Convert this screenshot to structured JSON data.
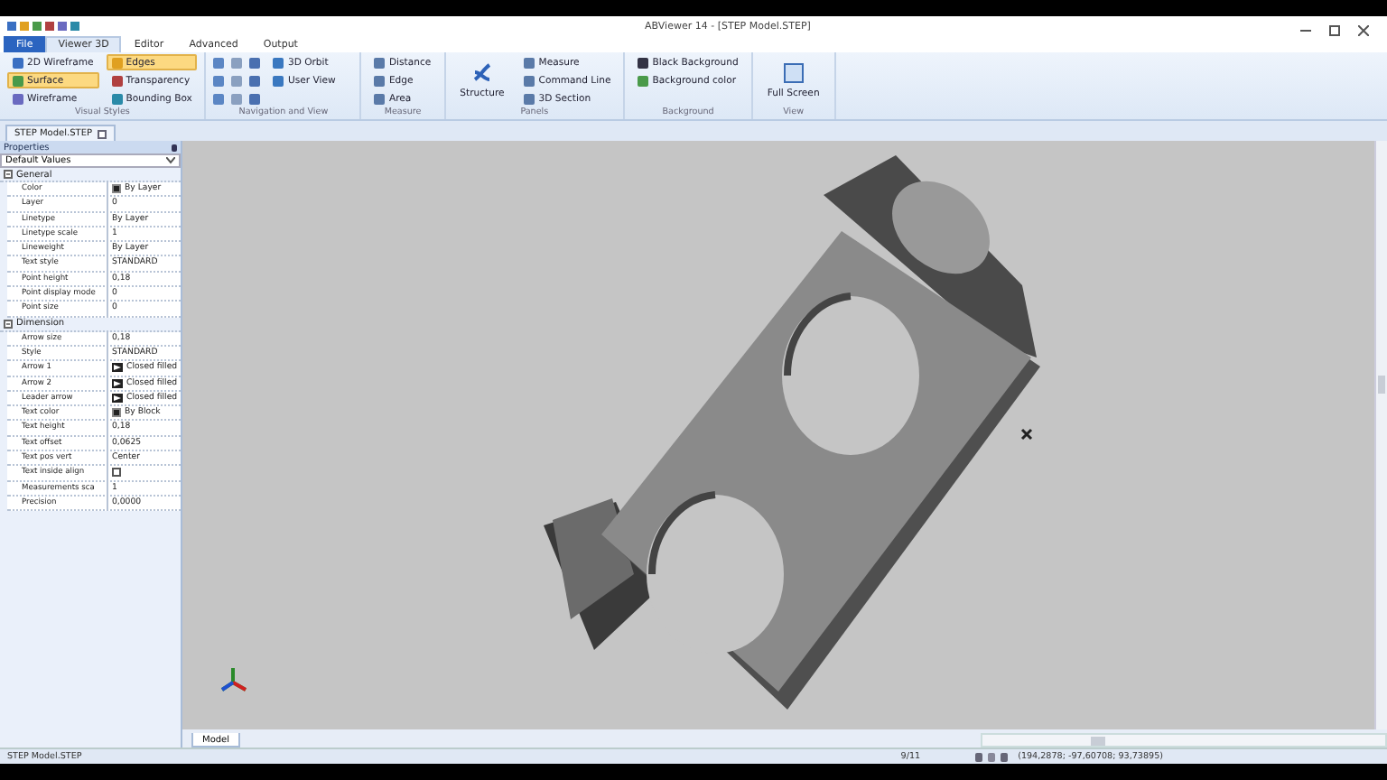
{
  "window": {
    "title": "ABViewer 14 - [STEP Model.STEP]"
  },
  "menu_tabs": [
    {
      "label": "File",
      "kind": "file",
      "selected": false
    },
    {
      "label": "Viewer 3D",
      "kind": "tab",
      "selected": true
    },
    {
      "label": "Editor",
      "kind": "tab",
      "selected": false
    },
    {
      "label": "Advanced",
      "kind": "tab",
      "selected": false
    },
    {
      "label": "Output",
      "kind": "tab",
      "selected": false
    }
  ],
  "ribbon": {
    "visual_styles": {
      "name": "Visual Styles",
      "items": [
        {
          "label": "2D Wireframe",
          "selected": false
        },
        {
          "label": "Edges",
          "selected": true
        },
        {
          "label": "Surface",
          "selected": true
        },
        {
          "label": "Transparency",
          "selected": false
        },
        {
          "label": "Wireframe",
          "selected": false
        },
        {
          "label": "Bounding Box",
          "selected": false
        }
      ]
    },
    "navigation": {
      "name": "Navigation and View",
      "items": [
        "3D Orbit",
        "User View"
      ]
    },
    "measure": {
      "name": "Measure",
      "items": [
        "Distance",
        "Edge",
        "Area"
      ]
    },
    "panels": {
      "name": "Panels",
      "large": "Structure",
      "items": [
        "Measure",
        "Command Line",
        "3D Section"
      ]
    },
    "background": {
      "name": "Background",
      "items": [
        "Black Background",
        "Background color"
      ]
    },
    "view": {
      "name": "View",
      "large": "Full Screen"
    }
  },
  "document_tab": "STEP Model.STEP",
  "properties": {
    "title": "Properties",
    "preset": "Default Values",
    "sections": [
      {
        "name": "General",
        "expanded": true,
        "rows": [
          {
            "name": "Color",
            "value": "By Layer",
            "kind": "swatch"
          },
          {
            "name": "Layer",
            "value": "0",
            "kind": "text"
          },
          {
            "name": "Linetype",
            "value": "By Layer",
            "kind": "text"
          },
          {
            "name": "Linetype scale",
            "value": "1",
            "kind": "text"
          },
          {
            "name": "Lineweight",
            "value": "By Layer",
            "kind": "text"
          },
          {
            "name": "Text style",
            "value": "STANDARD",
            "kind": "text"
          },
          {
            "name": "Point height",
            "value": "0,18",
            "kind": "text"
          },
          {
            "name": "Point display mode",
            "value": "0",
            "kind": "text"
          },
          {
            "name": "Point size",
            "value": "0",
            "kind": "text"
          }
        ]
      },
      {
        "name": "Dimension",
        "expanded": true,
        "rows": [
          {
            "name": "Arrow size",
            "value": "0,18",
            "kind": "text"
          },
          {
            "name": "Style",
            "value": "STANDARD",
            "kind": "text"
          },
          {
            "name": "Arrow 1",
            "value": "Closed filled",
            "kind": "arrow"
          },
          {
            "name": "Arrow 2",
            "value": "Closed filled",
            "kind": "arrow"
          },
          {
            "name": "Leader arrow",
            "value": "Closed filled",
            "kind": "arrow"
          },
          {
            "name": "Text color",
            "value": "By Block",
            "kind": "swatch"
          },
          {
            "name": "Text height",
            "value": "0,18",
            "kind": "text"
          },
          {
            "name": "Text offset",
            "value": "0,0625",
            "kind": "text"
          },
          {
            "name": "Text pos vert",
            "value": "Center",
            "kind": "text"
          },
          {
            "name": "Text inside align",
            "kind": "checkbox",
            "checked": false
          },
          {
            "name": "Measurements sca",
            "value": "1",
            "kind": "text"
          },
          {
            "name": "Precision",
            "value": "0,0000",
            "kind": "text"
          }
        ]
      }
    ]
  },
  "layout_tab": "Model",
  "status_bar": {
    "file": "STEP Model.STEP",
    "page": "9/11",
    "coordinates": "(194,2878; -97,60708; 93,73895)"
  }
}
